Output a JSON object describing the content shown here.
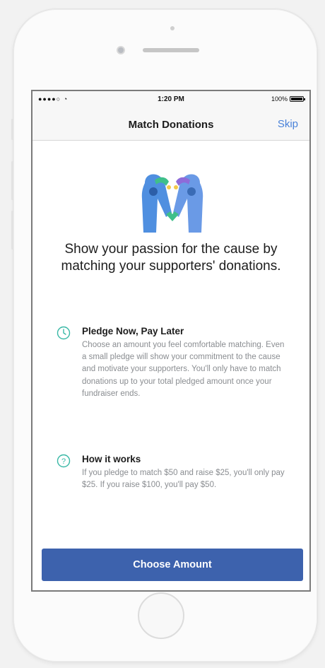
{
  "status_bar": {
    "carrier": "●●●●○",
    "time": "1:20 PM",
    "battery": "100%",
    "battery_level": 1.0
  },
  "nav": {
    "title": "Match Donations",
    "skip_label": "Skip"
  },
  "hero": {
    "icon": "heart-hands-illustration",
    "colors": {
      "blue": "#4f8fe0",
      "green": "#3fbf8a",
      "purple": "#8e6bd9",
      "yellow": "#f3c94a"
    }
  },
  "headline": "Show your passion for the cause by matching your supporters' donations.",
  "sections": [
    {
      "icon": "clock-icon",
      "title": "Pledge Now, Pay Later",
      "body": "Choose an amount you feel comfortable matching. Even a small pledge will show your commitment to the cause and motivate your supporters. You'll only have to match donations up to your total pledged amount once your fundraiser ends."
    },
    {
      "icon": "question-icon",
      "title": "How it works",
      "body": "If you pledge to match $50 and raise $25, you'll only pay $25. If you raise $100, you'll pay $50."
    }
  ],
  "cta": {
    "label": "Choose Amount"
  },
  "colors": {
    "accent": "#3d62ad",
    "link": "#4a82d9",
    "icon_teal": "#39b8a6"
  }
}
